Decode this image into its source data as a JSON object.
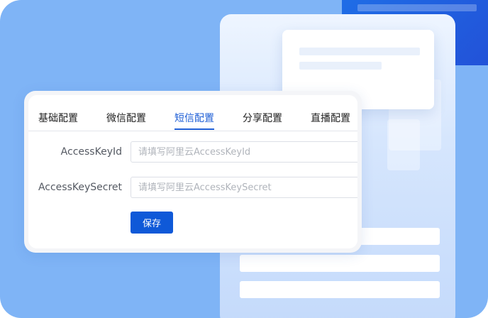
{
  "tabs": [
    {
      "label": "基础配置"
    },
    {
      "label": "微信配置"
    },
    {
      "label": "短信配置"
    },
    {
      "label": "分享配置"
    },
    {
      "label": "直播配置"
    }
  ],
  "active_tab": "短信配置",
  "form": {
    "access_key_id": {
      "label": "AccessKeyId",
      "placeholder": "请填写阿里云AccessKeyId",
      "value": ""
    },
    "access_key_secret": {
      "label": "AccessKeySecret",
      "placeholder": "请填写阿里云AccessKeySecret",
      "value": ""
    },
    "save_label": "保存"
  },
  "colors": {
    "accent": "#1f5fd6",
    "button": "#0f59d8",
    "background": "#7fb4f6"
  }
}
